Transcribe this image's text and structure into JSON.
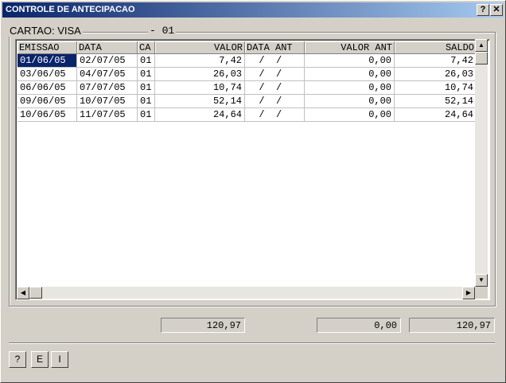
{
  "window": {
    "title": "CONTROLE DE ANTECIPACAO",
    "help_label": "?",
    "close_label": "✕"
  },
  "card": {
    "label": "CARTAO: VISA",
    "code": "- 01"
  },
  "grid": {
    "columns": [
      "EMISSAO",
      "DATA",
      "CA",
      "VALOR",
      "DATA ANT",
      "VALOR ANT",
      "SALDO"
    ],
    "rows": [
      [
        "01/06/05",
        "02/07/05",
        "01",
        "7,42",
        "  /  /",
        "0,00",
        "7,42"
      ],
      [
        "03/06/05",
        "04/07/05",
        "01",
        "26,03",
        "  /  /",
        "0,00",
        "26,03"
      ],
      [
        "06/06/05",
        "07/07/05",
        "01",
        "10,74",
        "  /  /",
        "0,00",
        "10,74"
      ],
      [
        "09/06/05",
        "10/07/05",
        "01",
        "52,14",
        "  /  /",
        "0,00",
        "52,14"
      ],
      [
        "10/06/05",
        "11/07/05",
        "01",
        "24,64",
        "  /  /",
        "0,00",
        "24,64"
      ]
    ],
    "selected_cell": "01/06/05"
  },
  "totals": {
    "valor": "120,97",
    "valor_ant": "0,00",
    "saldo": "120,97"
  },
  "buttons": {
    "help": "?",
    "e": "E",
    "i": "I"
  },
  "colors": {
    "title_start": "#0a246a",
    "title_end": "#a6caf0",
    "selection": "#0a246a",
    "face": "#d4d0c8"
  }
}
